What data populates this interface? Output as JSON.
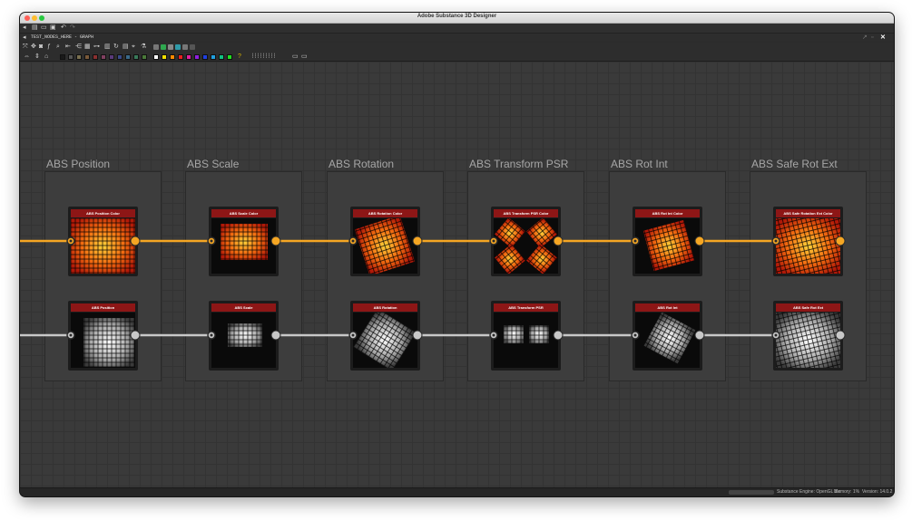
{
  "app": {
    "title": "Adobe Substance 3D Designer"
  },
  "graph_tab": {
    "label": "TEST_NODES_HERE - GRAPH"
  },
  "palette_colors": [
    "#1a1a1a",
    "#555555",
    "#7a7050",
    "#7a5a3a",
    "#8a3030",
    "#804060",
    "#5a3a7a",
    "#3a4a8a",
    "#3a6a8a",
    "#3a7a5a",
    "#4a7a3a",
    "#ffffff",
    "#f2e000",
    "#ff8a00",
    "#e82020",
    "#e020a0",
    "#9020e0",
    "#2040e0",
    "#20a0e0",
    "#10c080",
    "#20e020"
  ],
  "frames": [
    {
      "title": "ABS Position",
      "color_node": {
        "label": "ABS Position Color"
      },
      "gray_node": {
        "label": "ABS Position"
      }
    },
    {
      "title": "ABS Scale",
      "color_node": {
        "label": "ABS Scale Color"
      },
      "gray_node": {
        "label": "ABS Scale"
      }
    },
    {
      "title": "ABS Rotation",
      "color_node": {
        "label": "ABS Rotation Color"
      },
      "gray_node": {
        "label": "ABS Rotation"
      }
    },
    {
      "title": "ABS Transform PSR",
      "color_node": {
        "label": "ABS Transform PSR Color"
      },
      "gray_node": {
        "label": "ABS Transform PSR"
      }
    },
    {
      "title": "ABS Rot Int",
      "color_node": {
        "label": "ABS Rot Int Color"
      },
      "gray_node": {
        "label": "ABS Rot Int"
      }
    },
    {
      "title": "ABS Safe Rot Ext",
      "color_node": {
        "label": "ABS Safe Rotation Ext Color"
      },
      "gray_node": {
        "label": "ABS Safe Rot Ext"
      }
    }
  ],
  "wire_colors": {
    "color": "#f5a623",
    "gray": "#c8c8c8"
  },
  "status": {
    "engine": "Substance Engine: OpenGL 3.x",
    "memory": "Memory: 1%",
    "version": "Version: 14.0.2"
  }
}
